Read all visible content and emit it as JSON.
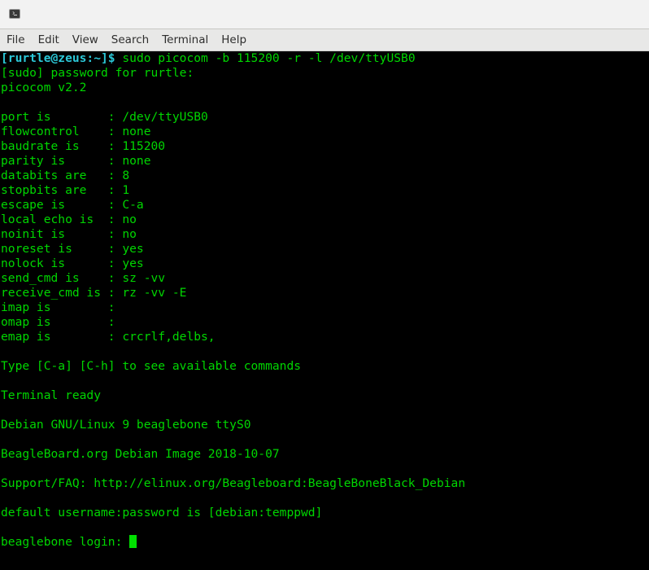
{
  "window": {
    "icon": "terminal-icon"
  },
  "menubar": {
    "items": [
      "File",
      "Edit",
      "View",
      "Search",
      "Terminal",
      "Help"
    ]
  },
  "terminal": {
    "colors": {
      "text": "#00d600",
      "prompt": "#2cc8d8",
      "background": "#000000"
    },
    "prompt": "[rurtle@zeus:~]$",
    "command": " sudo picocom -b 115200 -r -l /dev/ttyUSB0",
    "lines": [
      "[sudo] password for rurtle:",
      "picocom v2.2",
      "",
      "port is        : /dev/ttyUSB0",
      "flowcontrol    : none",
      "baudrate is    : 115200",
      "parity is      : none",
      "databits are   : 8",
      "stopbits are   : 1",
      "escape is      : C-a",
      "local echo is  : no",
      "noinit is      : no",
      "noreset is     : yes",
      "nolock is      : yes",
      "send_cmd is    : sz -vv",
      "receive_cmd is : rz -vv -E",
      "imap is        : ",
      "omap is        : ",
      "emap is        : crcrlf,delbs,",
      "",
      "Type [C-a] [C-h] to see available commands",
      "",
      "Terminal ready",
      "",
      "Debian GNU/Linux 9 beaglebone ttyS0",
      "",
      "BeagleBoard.org Debian Image 2018-10-07",
      "",
      "Support/FAQ: http://elinux.org/Beagleboard:BeagleBoneBlack_Debian",
      "",
      "default username:password is [debian:temppwd]",
      ""
    ],
    "login_prompt": "beaglebone login: "
  }
}
